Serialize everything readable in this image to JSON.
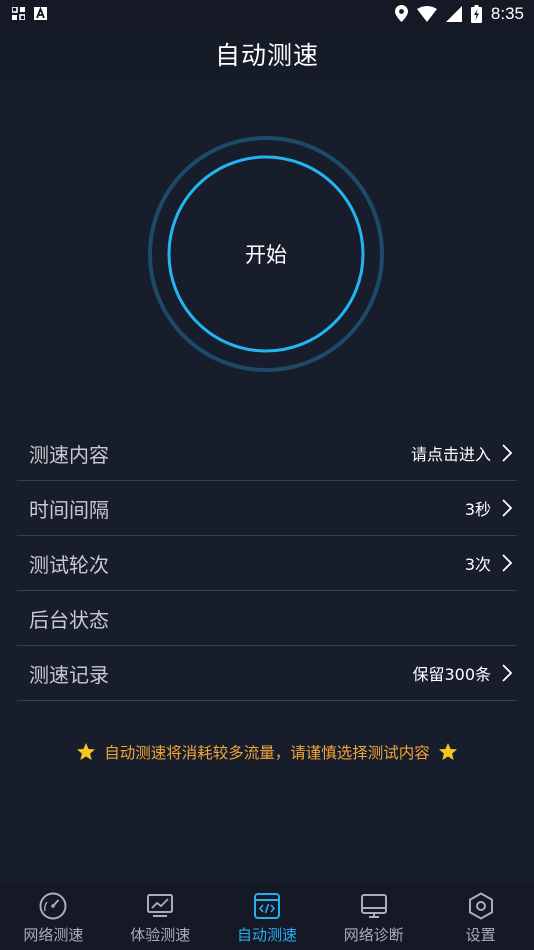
{
  "status_bar": {
    "time": "8:35"
  },
  "header": {
    "title": "自动测速"
  },
  "start_button": {
    "label": "开始"
  },
  "settings": [
    {
      "label": "测速内容",
      "value": "请点击进入",
      "has_arrow": true
    },
    {
      "label": "时间间隔",
      "value": "3秒",
      "has_arrow": true
    },
    {
      "label": "测试轮次",
      "value": "3次",
      "has_arrow": true
    },
    {
      "label": "后台状态",
      "value": "",
      "has_arrow": false
    },
    {
      "label": "测速记录",
      "value": "保留300条",
      "has_arrow": true
    }
  ],
  "notice": {
    "text": "自动测速将消耗较多流量，请谨慎选择测试内容"
  },
  "tabs": [
    {
      "label": "网络测速",
      "icon": "speedometer-icon",
      "active": false
    },
    {
      "label": "体验测速",
      "icon": "chart-monitor-icon",
      "active": false
    },
    {
      "label": "自动测速",
      "icon": "code-window-icon",
      "active": true
    },
    {
      "label": "网络诊断",
      "icon": "monitor-icon",
      "active": false
    },
    {
      "label": "设置",
      "icon": "hexagon-settings-icon",
      "active": false
    }
  ],
  "colors": {
    "accent": "#2aaef0",
    "background": "#181d2b",
    "notice": "#f0a438"
  }
}
